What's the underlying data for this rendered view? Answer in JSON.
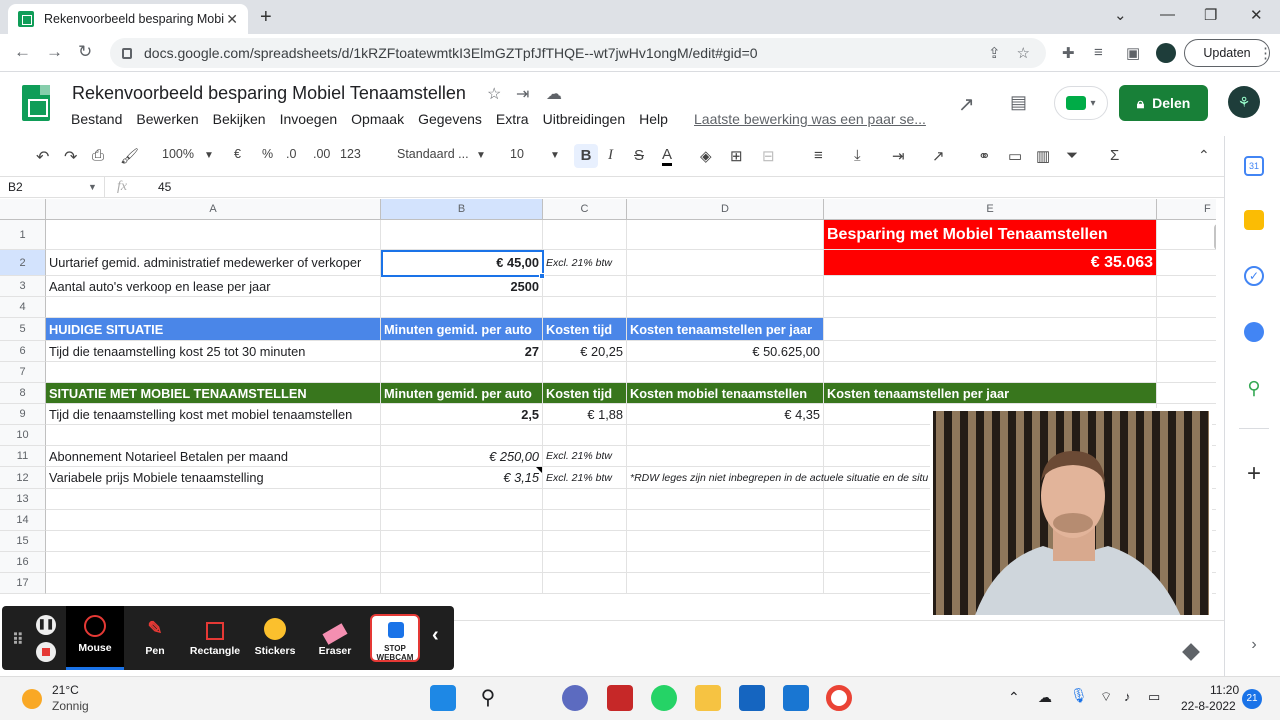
{
  "browser": {
    "tab_title": "Rekenvoorbeeld besparing Mobi",
    "url": "docs.google.com/spreadsheets/d/1kRZFtoatewmtkI3ElmGZTpfJfTHQE--wt7jwHv1ongM/edit#gid=0",
    "update_label": "Updaten"
  },
  "app": {
    "title": "Rekenvoorbeeld besparing Mobiel Tenaamstellen",
    "menus": [
      "Bestand",
      "Bewerken",
      "Bekijken",
      "Invoegen",
      "Opmaak",
      "Gegevens",
      "Extra",
      "Uitbreidingen",
      "Help"
    ],
    "last_edit": "Laatste bewerking was een paar se...",
    "share_label": "Delen"
  },
  "toolbar": {
    "zoom": "100%",
    "currency": "€",
    "percent": "%",
    "dec_less": ".0",
    "dec_more": ".00",
    "format_more": "123",
    "font": "Standaard ...",
    "font_size": "10"
  },
  "formula": {
    "cell_ref": "B2",
    "fx": "fx",
    "value": "45"
  },
  "columns": [
    "A",
    "B",
    "C",
    "D",
    "E",
    "F"
  ],
  "rows": [
    "1",
    "2",
    "3",
    "4",
    "5",
    "6",
    "7",
    "8",
    "9",
    "10",
    "11",
    "12",
    "13",
    "14",
    "15",
    "16",
    "17"
  ],
  "cells": {
    "E1": "Besparing met Mobiel Tenaamstellen",
    "E2": "€ 35.063",
    "A2": "Uurtarief gemid. administratief medewerker of verkoper",
    "B2": "€ 45,00",
    "C2": "Excl. 21% btw",
    "A3": "Aantal auto's verkoop en lease per jaar",
    "B3": "2500",
    "A5": "HUIDIGE SITUATIE",
    "B5": "Minuten gemid. per auto",
    "C5": "Kosten tijd",
    "D5": "Kosten tenaamstellen per jaar",
    "A6": "Tijd die tenaamstelling kost 25 tot 30 minuten",
    "B6": "27",
    "C6": "€ 20,25",
    "D6": "€ 50.625,00",
    "A8": "SITUATIE MET MOBIEL TENAAMSTELLEN",
    "B8": "Minuten gemid. per auto",
    "C8": "Kosten tijd",
    "D8": "Kosten mobiel tenaamstellen",
    "E8": "Kosten tenaamstellen per jaar",
    "A9": "Tijd die tenaamstelling kost met mobiel tenaamstellen",
    "B9": "2,5",
    "C9": "€ 1,88",
    "D9": "€ 4,35",
    "A11": "Abonnement Notarieel Betalen per maand",
    "B11": "€ 250,00",
    "C11": "Excl. 21% btw",
    "A12": "Variabele prijs Mobiele tenaamstelling",
    "B12": "€ 3,15",
    "C12": "Excl. 21% btw",
    "D12": "*RDW leges zijn niet inbegrepen in de actuele situatie en de situ"
  },
  "recorder": {
    "tools": [
      "Mouse",
      "Pen",
      "Rectangle",
      "Stickers",
      "Eraser"
    ],
    "webcam_label": "STOP WEBCAM"
  },
  "taskbar": {
    "temp": "21°C",
    "weather": "Zonnig",
    "time": "11:20",
    "date": "22-8-2022",
    "badge": "21"
  }
}
